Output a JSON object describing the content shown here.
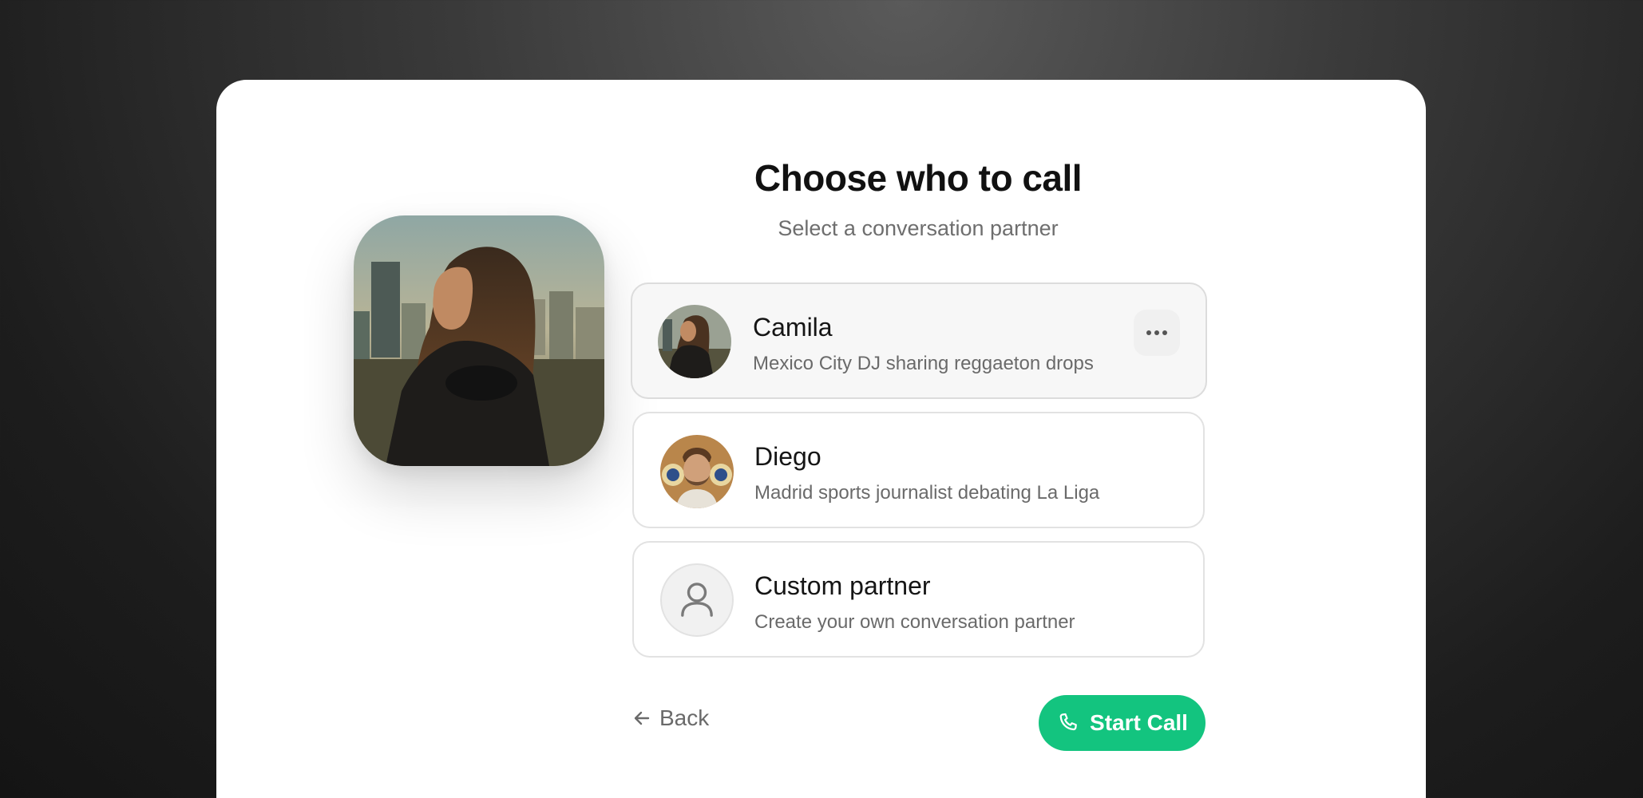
{
  "header": {
    "title": "Choose who to call",
    "subtitle": "Select a conversation partner"
  },
  "partners": [
    {
      "name": "Camila",
      "description": "Mexico City DJ sharing reggaeton drops",
      "avatar_icon": "camila-photo",
      "selected": true
    },
    {
      "name": "Diego",
      "description": "Madrid sports journalist debating La Liga",
      "avatar_icon": "diego-photo",
      "selected": false
    },
    {
      "name": "Custom partner",
      "description": "Create your own conversation partner",
      "avatar_icon": "user-icon",
      "selected": false
    }
  ],
  "footer": {
    "back_label": "Back",
    "start_label": "Start Call"
  },
  "colors": {
    "accent": "#13c47f",
    "card_background": "#ffffff",
    "selected_background": "#f7f7f7"
  }
}
